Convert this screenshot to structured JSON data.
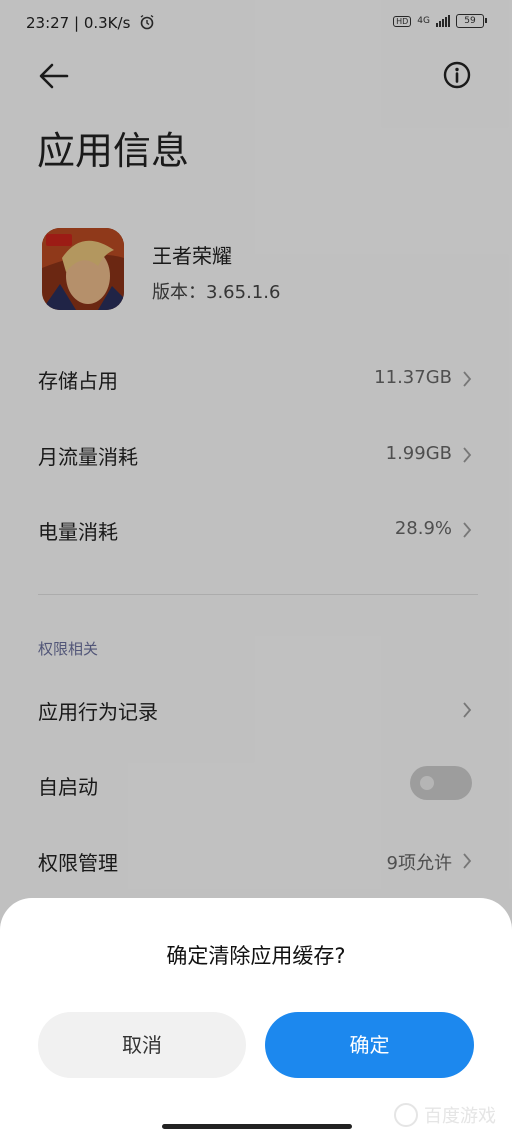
{
  "status_bar": {
    "time_speed": "23:27 | 0.3K/s",
    "hd": "HD",
    "network": "4G",
    "battery": "59"
  },
  "page": {
    "title": "应用信息"
  },
  "app": {
    "name": "王者荣耀",
    "version_label": "版本：",
    "version": "3.65.1.6"
  },
  "rows": [
    {
      "label": "存储占用",
      "value": "11.37GB"
    },
    {
      "label": "月流量消耗",
      "value": "1.99GB"
    },
    {
      "label": "电量消耗",
      "value": "28.9%"
    }
  ],
  "permissions": {
    "section_title": "权限相关",
    "behavior_record_label": "应用行为记录",
    "autostart_label": "自启动",
    "autostart_enabled": false,
    "manage_label": "权限管理",
    "manage_value": "9项允许"
  },
  "dialog": {
    "title": "确定清除应用缓存?",
    "cancel_label": "取消",
    "ok_label": "确定"
  },
  "watermark": {
    "text": "百度游戏"
  },
  "colors": {
    "accent": "#1c88ee",
    "section_label": "#6a6f9a"
  }
}
